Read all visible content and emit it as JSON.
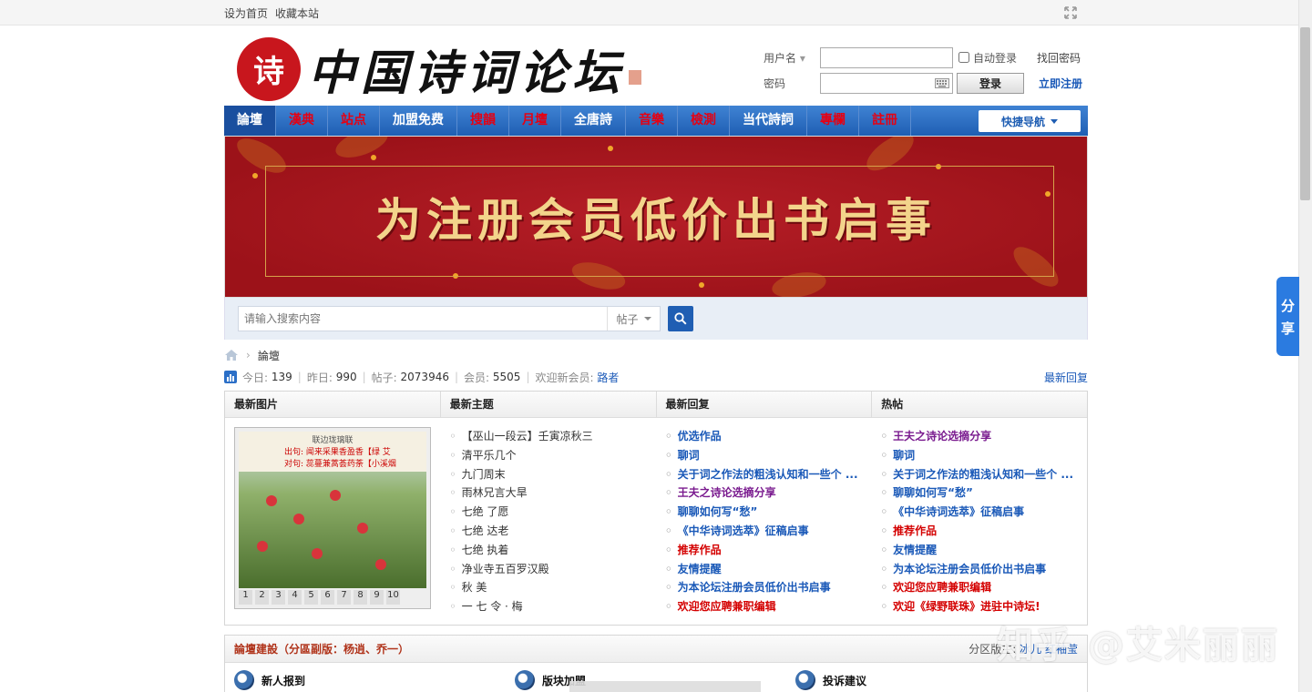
{
  "topbar": {
    "set_home": "设为首页",
    "bookmark": "收藏本站"
  },
  "logo": {
    "seal_char": "诗",
    "title": "中国诗词论坛"
  },
  "login": {
    "username_label": "用户名",
    "password_label": "密码",
    "auto_login": "自动登录",
    "login_button": "登录",
    "find_password": "找回密码",
    "register": "立即注册"
  },
  "nav": {
    "items": [
      {
        "label": "論壇",
        "style": "active"
      },
      {
        "label": "漢典",
        "style": "red"
      },
      {
        "label": "站点",
        "style": "red"
      },
      {
        "label": "加盟免费",
        "style": "white"
      },
      {
        "label": "搜韻",
        "style": "red"
      },
      {
        "label": "月壇",
        "style": "red"
      },
      {
        "label": "全唐詩",
        "style": "white"
      },
      {
        "label": "音樂",
        "style": "red"
      },
      {
        "label": "檢測",
        "style": "red"
      },
      {
        "label": "当代詩詞",
        "style": "white"
      },
      {
        "label": "專欄",
        "style": "red"
      },
      {
        "label": "註冊",
        "style": "red"
      }
    ],
    "quick_nav": "快捷导航"
  },
  "banner": {
    "title": "为注册会员低价出书启事"
  },
  "search": {
    "placeholder": "请输入搜索内容",
    "type": "帖子"
  },
  "breadcrumb": {
    "current": "論壇"
  },
  "stats": {
    "today_label": "今日:",
    "today": "139",
    "yesterday_label": "昨日:",
    "yesterday": "990",
    "posts_label": "帖子:",
    "posts": "2073946",
    "members_label": "会员:",
    "members": "5505",
    "welcome_label": "欢迎新会员:",
    "newest_member": "路者",
    "latest_reply": "最新回复"
  },
  "panel": {
    "headers": [
      "最新图片",
      "最新主题",
      "最新回复",
      "热帖"
    ],
    "slide": {
      "poem_title": "联边珑璃联",
      "poem_line1": "出句: 闻来采果香盈香【绿 艾",
      "poem_line2": "对句: 蕊蔓兼蒿荟药荼【小溪烟",
      "numbers": [
        "1",
        "2",
        "3",
        "4",
        "5",
        "6",
        "7",
        "8",
        "9",
        "10"
      ]
    },
    "latest_topics": [
      {
        "text": "【巫山一段云】壬寅凉秋三",
        "style": "plain"
      },
      {
        "text": "清平乐几个",
        "style": "plain"
      },
      {
        "text": "九门周末",
        "style": "plain"
      },
      {
        "text": "雨林兄言大旱",
        "style": "plain"
      },
      {
        "text": "七绝 了愿",
        "style": "plain"
      },
      {
        "text": "七绝 达老",
        "style": "plain"
      },
      {
        "text": "七绝 执着",
        "style": "plain"
      },
      {
        "text": "净业寺五百罗汉殿",
        "style": "plain"
      },
      {
        "text": "秋 美",
        "style": "plain"
      },
      {
        "text": "一 七 令 · 梅",
        "style": "plain"
      }
    ],
    "latest_replies": [
      {
        "text": "优选作品",
        "style": "blue"
      },
      {
        "text": "聊词",
        "style": "blue"
      },
      {
        "text": "关于词之作法的粗浅认知和一些个 ...",
        "style": "blue"
      },
      {
        "text": "王夫之诗论选摘分享",
        "style": "purple"
      },
      {
        "text": "聊聊如何写“愁”",
        "style": "blue"
      },
      {
        "text": "《中华诗词选萃》征稿启事",
        "style": "blue"
      },
      {
        "text": "推荐作品",
        "style": "red"
      },
      {
        "text": "友情提醒",
        "style": "blue"
      },
      {
        "text": "为本论坛注册会员低价出书启事",
        "style": "blue"
      },
      {
        "text": "欢迎您应聘兼职编辑",
        "style": "red"
      }
    ],
    "hot_posts": [
      {
        "text": "王夫之诗论选摘分享",
        "style": "purple"
      },
      {
        "text": "聊词",
        "style": "blue"
      },
      {
        "text": "关于词之作法的粗浅认知和一些个 ...",
        "style": "blue"
      },
      {
        "text": "聊聊如何写“愁”",
        "style": "blue"
      },
      {
        "text": "《中华诗词选萃》征稿启事",
        "style": "blue"
      },
      {
        "text": "推荐作品",
        "style": "red"
      },
      {
        "text": "友情提醒",
        "style": "blue"
      },
      {
        "text": "为本论坛注册会员低价出书启事",
        "style": "blue"
      },
      {
        "text": "欢迎您应聘兼职编辑",
        "style": "red"
      },
      {
        "text": "欢迎《绿野联珠》进驻中诗坛!",
        "style": "red"
      }
    ]
  },
  "section": {
    "title": "論壇建設（分區副版：杨逍、乔一）",
    "moderator_label": "分区版主:",
    "moderator_value": "冰儿 红袖莹",
    "forums": [
      "新人报到",
      "版块加盟",
      "投诉建议"
    ]
  },
  "share": {
    "label_1": "分",
    "label_2": "享"
  },
  "watermark": "知乎 @艾米丽丽",
  "colors": {
    "nav_blue": "#1f5eb3",
    "link_blue": "#1a59b8",
    "alert_red": "#d40000",
    "banner_red": "#9c1219"
  }
}
